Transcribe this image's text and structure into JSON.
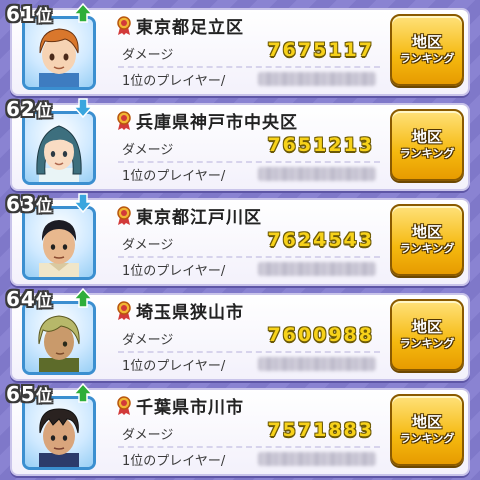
{
  "rank_suffix": "位",
  "damage_label": "ダメージ",
  "top_player_label": "1位のプレイヤー/",
  "button": {
    "line1": "地区",
    "line2": "ランキング"
  },
  "colors": {
    "up": "#2fae3a",
    "down": "#3aa6de",
    "value": "#f7d21a",
    "button": "#f5b90f"
  },
  "rows": [
    {
      "rank": "61",
      "trend": "up",
      "trend_icon": "arrow-up-icon",
      "region": "東京都足立区",
      "damage": "7675117",
      "avatar": "orange-hair-boy"
    },
    {
      "rank": "62",
      "trend": "down",
      "trend_icon": "arrow-down-icon",
      "region": "兵庫県神戸市中央区",
      "damage": "7651213",
      "avatar": "teal-hair-girl"
    },
    {
      "rank": "63",
      "trend": "down",
      "trend_icon": "arrow-down-icon",
      "region": "東京都江戸川区",
      "damage": "7624543",
      "avatar": "dark-hair-man"
    },
    {
      "rank": "64",
      "trend": "up",
      "trend_icon": "arrow-up-icon",
      "region": "埼玉県狭山市",
      "damage": "7600988",
      "avatar": "green-hair-boy"
    },
    {
      "rank": "65",
      "trend": "up",
      "trend_icon": "arrow-up-icon",
      "region": "千葉県市川市",
      "damage": "7571883",
      "avatar": "dark-hair-boy"
    }
  ]
}
